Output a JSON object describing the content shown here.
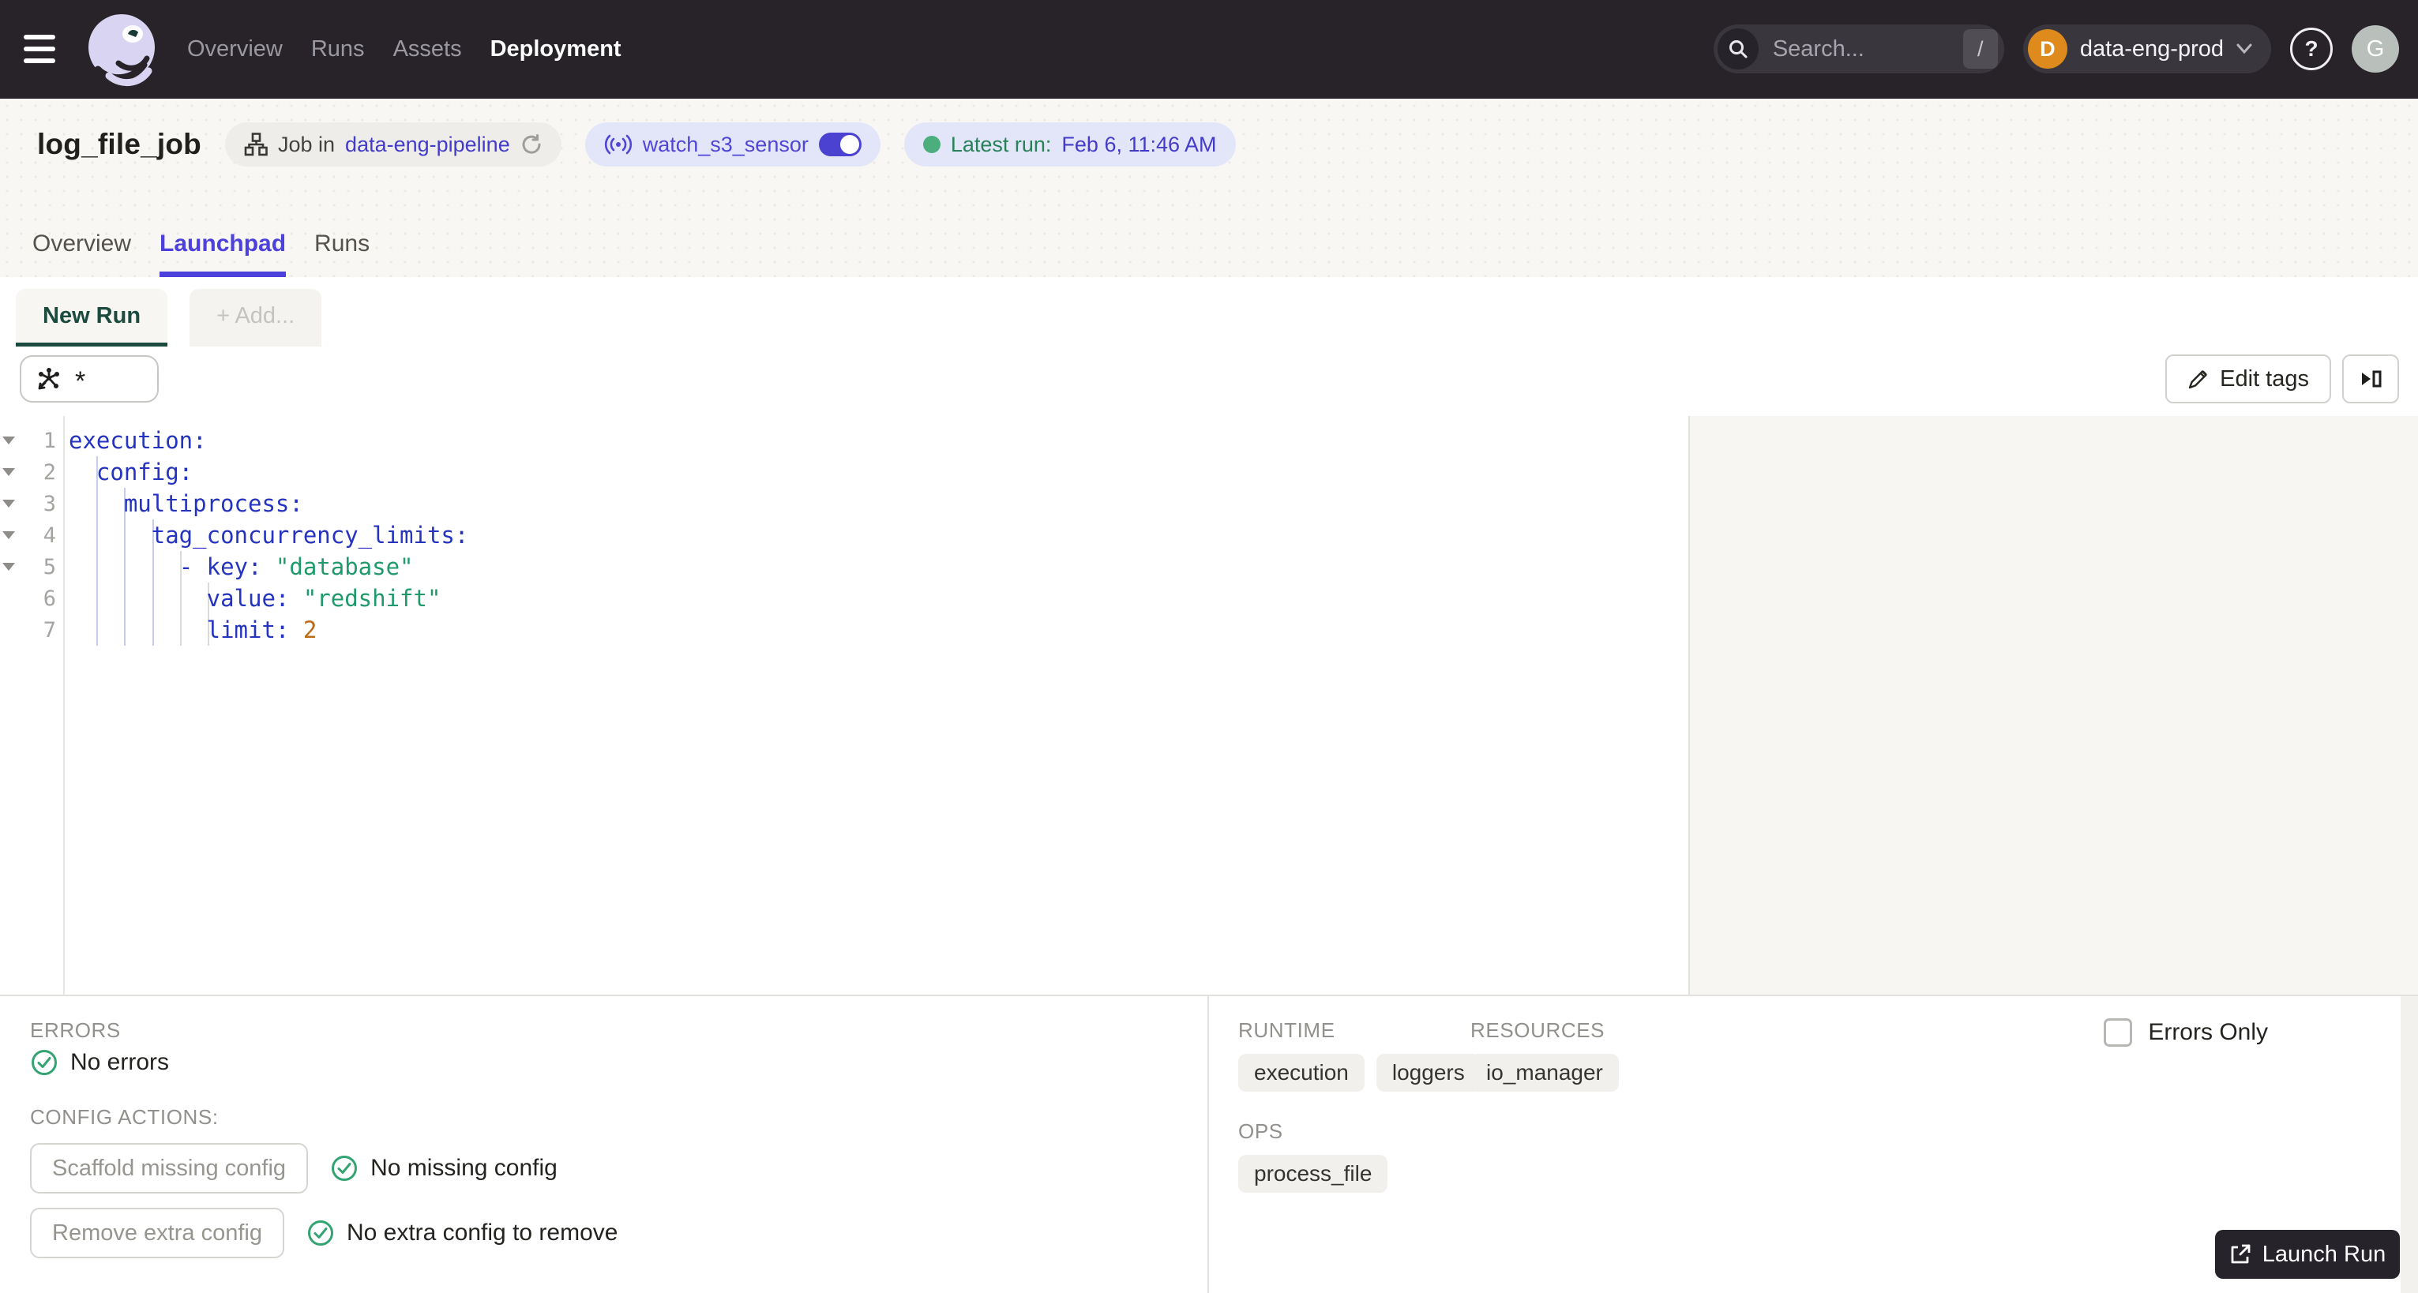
{
  "nav": {
    "items": [
      {
        "label": "Overview",
        "active": false
      },
      {
        "label": "Runs",
        "active": false
      },
      {
        "label": "Assets",
        "active": false
      },
      {
        "label": "Deployment",
        "active": true
      }
    ],
    "search_placeholder": "Search...",
    "search_shortcut": "/",
    "deployment": {
      "initial": "D",
      "name": "data-eng-prod"
    },
    "avatar_initial": "G"
  },
  "header": {
    "title": "log_file_job",
    "job_badge": {
      "prefix": "Job in",
      "repo": "data-eng-pipeline"
    },
    "sensor_badge": {
      "label": "watch_s3_sensor"
    },
    "latest_run": {
      "prefix": "Latest run:",
      "value": "Feb 6, 11:46 AM"
    }
  },
  "tabs": [
    {
      "label": "Overview",
      "active": false
    },
    {
      "label": "Launchpad",
      "active": true
    },
    {
      "label": "Runs",
      "active": false
    }
  ],
  "launchpad": {
    "run_tab": "New Run",
    "add_tab": "+ Add...",
    "op_selector_value": "*",
    "edit_tags_label": "Edit tags"
  },
  "editor": {
    "lines": [
      {
        "n": "1",
        "fold": true,
        "segs": [
          [
            "execution:",
            "k"
          ]
        ]
      },
      {
        "n": "2",
        "fold": true,
        "segs": [
          [
            "  ",
            "p"
          ],
          [
            "config:",
            "k"
          ]
        ]
      },
      {
        "n": "3",
        "fold": true,
        "segs": [
          [
            "    ",
            "p"
          ],
          [
            "multiprocess:",
            "k"
          ]
        ]
      },
      {
        "n": "4",
        "fold": true,
        "segs": [
          [
            "      ",
            "p"
          ],
          [
            "tag_concurrency_limits:",
            "k"
          ]
        ]
      },
      {
        "n": "5",
        "fold": true,
        "segs": [
          [
            "        ",
            "p"
          ],
          [
            "- ",
            "k"
          ],
          [
            "key:",
            "k"
          ],
          [
            " ",
            "p"
          ],
          [
            "\"database\"",
            "s"
          ]
        ]
      },
      {
        "n": "6",
        "fold": false,
        "segs": [
          [
            "          ",
            "p"
          ],
          [
            "value:",
            "k"
          ],
          [
            " ",
            "p"
          ],
          [
            "\"redshift\"",
            "s"
          ]
        ]
      },
      {
        "n": "7",
        "fold": false,
        "segs": [
          [
            "          ",
            "p"
          ],
          [
            "limit:",
            "k"
          ],
          [
            " ",
            "p"
          ],
          [
            "2",
            "n"
          ]
        ]
      }
    ]
  },
  "bottom": {
    "errors": {
      "label": "ERRORS",
      "message": "No errors"
    },
    "config_actions": {
      "label": "CONFIG ACTIONS:",
      "actions": [
        {
          "button": "Scaffold missing config",
          "status": "No missing config"
        },
        {
          "button": "Remove extra config",
          "status": "No extra config to remove"
        }
      ]
    },
    "runtime": {
      "label": "RUNTIME",
      "tags": [
        "execution",
        "loggers"
      ]
    },
    "resources": {
      "label": "RESOURCES",
      "tags": [
        "io_manager"
      ]
    },
    "ops": {
      "label": "OPS",
      "tags": [
        "process_file"
      ]
    },
    "errors_only_label": "Errors Only",
    "launch_label": "Launch Run"
  },
  "colors": {
    "accent_indigo": "#4D41DC",
    "link_indigo": "#433BC9",
    "active_green": "#1B4A3E",
    "success_green": "#33A372",
    "status_green_text": "#27825A",
    "nav_bg": "#272329",
    "deployment_avatar": "#DE8A1C",
    "code_key": "#2433C0",
    "code_string": "#1E9A6B",
    "code_number": "#BD6A15"
  }
}
